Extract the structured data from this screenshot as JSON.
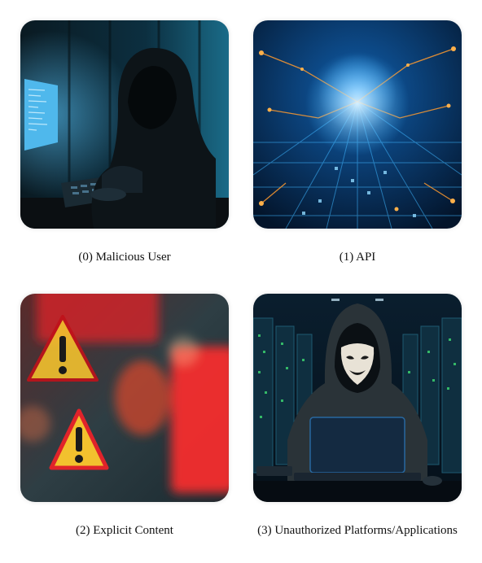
{
  "panels": [
    {
      "caption": "(0) Malicious User",
      "image": "hooded-hacker-at-computer"
    },
    {
      "caption": "(1) API",
      "image": "glowing-circuit-network"
    },
    {
      "caption": "(2) Explicit Content",
      "image": "warning-signs-red-bokeh"
    },
    {
      "caption": "(3) Unauthorized Platforms/Applications",
      "image": "masked-hacker-in-server-room"
    }
  ],
  "colors": {
    "hacker_blue": "#0b3a52",
    "circuit_glow": "#3fb6ff",
    "circuit_orange": "#ff9a2e",
    "warning_yellow": "#f2c12e",
    "warning_red": "#e0232a",
    "server_green": "#3bd16f"
  }
}
